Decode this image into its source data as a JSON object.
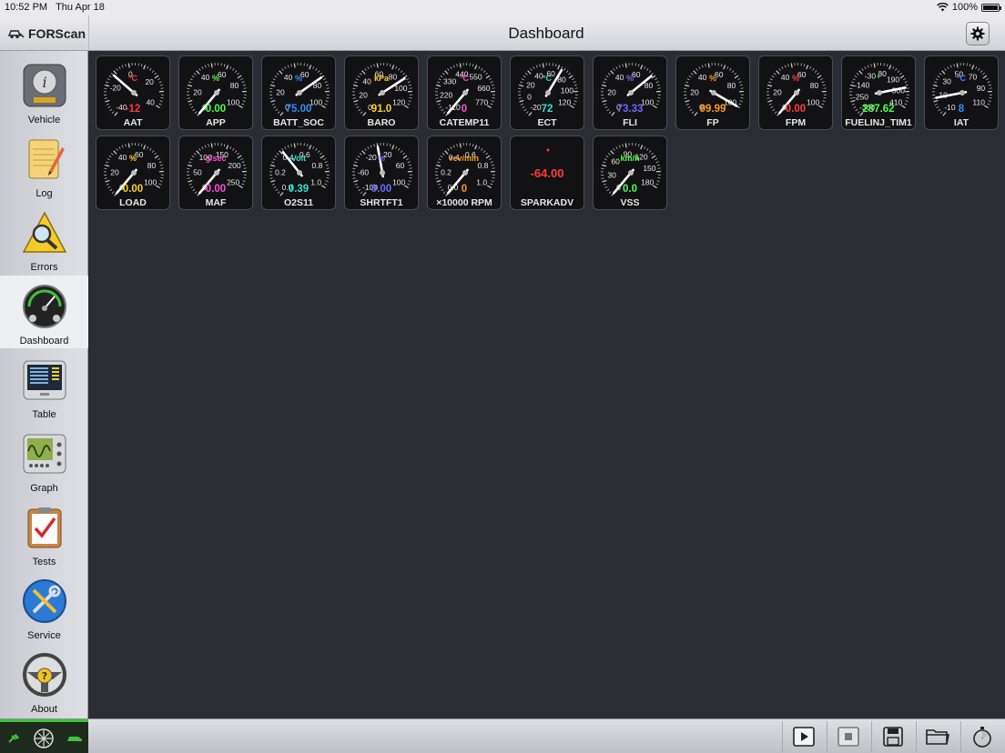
{
  "status": {
    "time": "10:52 PM",
    "date": "Thu Apr 18",
    "battery": "100%"
  },
  "app": {
    "brand": "FORScan",
    "title": "Dashboard"
  },
  "sidebar": {
    "items": [
      {
        "label": "Vehicle"
      },
      {
        "label": "Log"
      },
      {
        "label": "Errors"
      },
      {
        "label": "Dashboard"
      },
      {
        "label": "Table"
      },
      {
        "label": "Graph"
      },
      {
        "label": "Tests"
      },
      {
        "label": "Service"
      },
      {
        "label": "About"
      }
    ],
    "active": "Dashboard"
  },
  "gauges": [
    {
      "name": "AAT",
      "value": "-12",
      "unit": "°C",
      "color": "#ff3b3b",
      "ticks": [
        "-40",
        "-20",
        "0",
        "20",
        "40"
      ],
      "min": -40,
      "max": 40,
      "reading": -12
    },
    {
      "name": "APP",
      "value": "0.00",
      "unit": "%",
      "color": "#4cff4c",
      "ticks": [
        "0",
        "20",
        "40",
        "60",
        "80",
        "100"
      ],
      "min": 0,
      "max": 100,
      "reading": 0
    },
    {
      "name": "BATT_SOC",
      "value": "75.00",
      "unit": "%",
      "color": "#2e8fff",
      "ticks": [
        "0",
        "20",
        "40",
        "60",
        "80",
        "100"
      ],
      "min": 0,
      "max": 100,
      "reading": 75
    },
    {
      "name": "BARO",
      "value": "91.0",
      "unit": "kPa",
      "color": "#ffd21e",
      "ticks": [
        "0",
        "20",
        "40",
        "60",
        "80",
        "100",
        "120"
      ],
      "min": 0,
      "max": 120,
      "reading": 91
    },
    {
      "name": "CATEMP11",
      "value": "0",
      "unit": "°C",
      "color": "#ff4fd8",
      "ticks": [
        "-110",
        "220",
        "330",
        "440",
        "550",
        "660",
        "770"
      ],
      "min": 0,
      "max": 770,
      "reading": 0
    },
    {
      "name": "ECT",
      "value": "72",
      "unit": "°C",
      "color": "#32e0d0",
      "ticks": [
        "-20",
        "0",
        "20",
        "40",
        "60",
        "80",
        "100",
        "120"
      ],
      "min": -20,
      "max": 120,
      "reading": 72
    },
    {
      "name": "FLI",
      "value": "73.33",
      "unit": "%",
      "color": "#6b6bff",
      "ticks": [
        "0",
        "20",
        "40",
        "60",
        "80",
        "100"
      ],
      "min": 0,
      "max": 100,
      "reading": 73.33
    },
    {
      "name": "FP",
      "value": "99.99",
      "unit": "%",
      "color": "#ff9a1e",
      "ticks": [
        "0",
        "20",
        "40",
        "60",
        "80",
        "100"
      ],
      "min": 0,
      "max": 100,
      "reading": 99.99
    },
    {
      "name": "FPM",
      "value": "0.00",
      "unit": "%",
      "color": "#ff3b3b",
      "ticks": [
        "0",
        "20",
        "40",
        "60",
        "80",
        "100"
      ],
      "min": 0,
      "max": 100,
      "reading": 0
    },
    {
      "name": "FUELINJ_TIM1",
      "value": "287.62",
      "unit": "°",
      "color": "#4cff4c",
      "ticks": [
        "-360",
        "-250",
        "-140",
        "-30",
        "80",
        "190",
        "300",
        "410"
      ],
      "min": -360,
      "max": 410,
      "reading": 287.62
    },
    {
      "name": "IAT",
      "value": "8",
      "unit": "°C",
      "color": "#2e8fff",
      "ticks": [
        "-10",
        "10",
        "30",
        "50",
        "70",
        "90",
        "110"
      ],
      "min": -10,
      "max": 110,
      "reading": 8
    },
    {
      "name": "LOAD",
      "value": "0.00",
      "unit": "%",
      "color": "#ffd21e",
      "ticks": [
        "0",
        "20",
        "40",
        "60",
        "80",
        "100"
      ],
      "min": 0,
      "max": 100,
      "reading": 0
    },
    {
      "name": "MAF",
      "value": "0.00",
      "unit": "g/sec",
      "color": "#ff4fd8",
      "ticks": [
        "0",
        "50",
        "100",
        "150",
        "200",
        "250"
      ],
      "min": 0,
      "max": 250,
      "reading": 0
    },
    {
      "name": "O2S11",
      "value": "0.39",
      "unit": "Volt",
      "color": "#32e0d0",
      "ticks": [
        "0.0",
        "0.2",
        "0.4",
        "0.6",
        "0.8",
        "1.0"
      ],
      "min": 0,
      "max": 1,
      "reading": 0.39
    },
    {
      "name": "SHRTFT1",
      "value": "0.00",
      "unit": "%",
      "color": "#6b6bff",
      "ticks": [
        "-100",
        "-60",
        "-20",
        "20",
        "60",
        "100"
      ],
      "min": -100,
      "max": 100,
      "reading": 0
    },
    {
      "name": "×10000 RPM",
      "value": "0",
      "unit": "rev/min",
      "color": "#ff9a1e",
      "ticks": [
        "0.0",
        "0.2",
        "0.4",
        "0.6",
        "0.8",
        "1.0"
      ],
      "min": 0,
      "max": 1,
      "reading": 0
    },
    {
      "name": "SPARKADV",
      "value": "-64.00",
      "unit": "°",
      "color": "#ff3b3b",
      "digital": true
    },
    {
      "name": "VSS",
      "value": "0.0",
      "unit": "km/h",
      "color": "#4cff4c",
      "ticks": [
        "0",
        "30",
        "60",
        "90",
        "120",
        "150",
        "180"
      ],
      "min": 0,
      "max": 180,
      "reading": 0
    }
  ],
  "colors": {
    "connection_ok": "#3ec43a"
  },
  "toolbar": {
    "icons": [
      "play-icon",
      "stop-icon",
      "save-icon",
      "folder-icon",
      "stopwatch-icon"
    ]
  }
}
